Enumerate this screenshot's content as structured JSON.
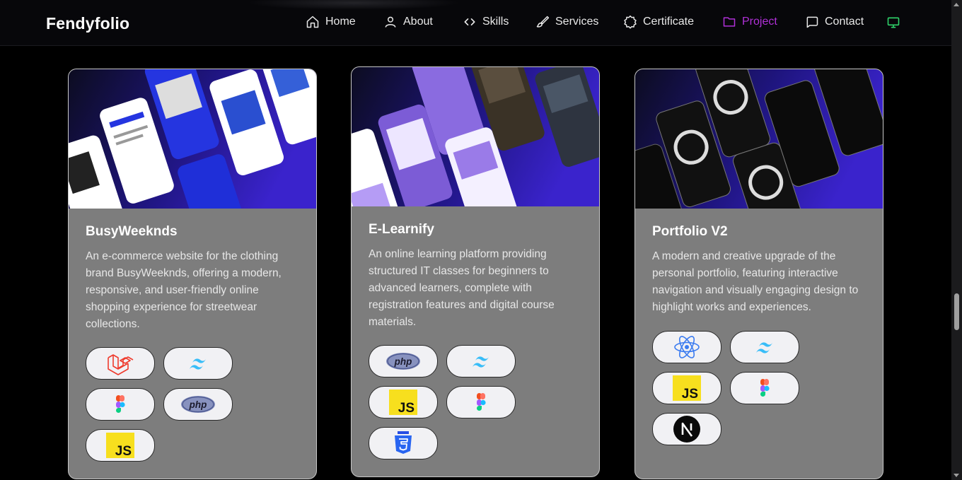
{
  "nav": {
    "brand": "Fendyfolio",
    "items": [
      {
        "label": "Home",
        "icon": "home-icon",
        "active": false
      },
      {
        "label": "About",
        "icon": "user-icon",
        "active": false
      },
      {
        "label": "Skills",
        "icon": "code-icon",
        "active": false
      },
      {
        "label": "Services",
        "icon": "brush-icon",
        "active": false
      },
      {
        "label": "Certificate",
        "icon": "badge-icon",
        "active": false
      },
      {
        "label": "Project",
        "icon": "folder-icon",
        "active": true
      },
      {
        "label": "Contact",
        "icon": "chat-icon",
        "active": false
      }
    ],
    "theme_toggle_icon": "monitor-icon",
    "colors": {
      "active": "#b030d8",
      "theme_toggle": "#2fd36a"
    }
  },
  "projects": [
    {
      "title": "BusyWeeknds",
      "description": "An e-commerce website for the clothing brand BusyWeeknds, offering a modern, responsive, and user-friendly online shopping experience for streetwear collections.",
      "tech": [
        "laravel-icon",
        "tailwind-icon",
        "figma-icon",
        "php-icon",
        "javascript-icon"
      ]
    },
    {
      "title": "E-Learnify",
      "description": "An online learning platform providing structured IT classes for beginners to advanced learners, complete with registration features and digital course materials.",
      "tech": [
        "php-icon",
        "tailwind-icon",
        "javascript-icon",
        "figma-icon",
        "css3-icon"
      ]
    },
    {
      "title": "Portfolio V2",
      "description": "A modern and creative upgrade of the personal portfolio, featuring interactive navigation and visually engaging design to highlight works and experiences.",
      "tech": [
        "react-icon",
        "tailwind-icon",
        "javascript-icon",
        "figma-icon",
        "nextjs-icon"
      ]
    }
  ],
  "tech_logos": {
    "php": "php",
    "javascript": "JS"
  },
  "accent_colors": {
    "card_bg": "#7d7d7d",
    "thumbnail_gradient": "#3320c0"
  }
}
